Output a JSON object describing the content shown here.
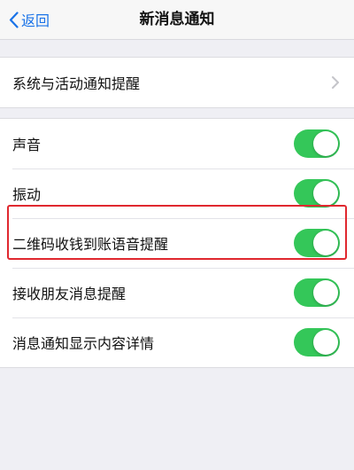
{
  "navbar": {
    "back_label": "返回",
    "title": "新消息通知"
  },
  "group1": {
    "items": [
      {
        "label": "系统与活动通知提醒"
      }
    ]
  },
  "group2": {
    "items": [
      {
        "label": "声音",
        "enabled": true
      },
      {
        "label": "振动",
        "enabled": true
      },
      {
        "label": "二维码收钱到账语音提醒",
        "enabled": true,
        "highlighted": true
      },
      {
        "label": "接收朋友消息提醒",
        "enabled": true
      },
      {
        "label": "消息通知显示内容详情",
        "enabled": true
      }
    ]
  },
  "colors": {
    "accent": "#1a73e8",
    "toggle_on": "#34c759",
    "highlight_border": "#e0282f",
    "background": "#efeff4"
  },
  "icons": {
    "back": "chevron-left-icon",
    "disclosure": "chevron-right-icon"
  }
}
